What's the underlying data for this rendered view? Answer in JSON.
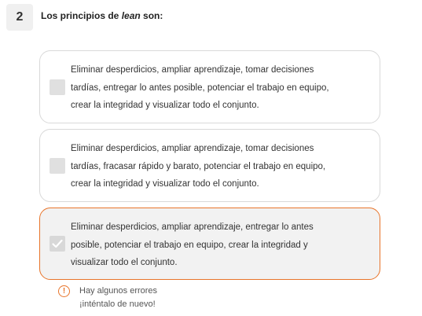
{
  "question": {
    "number": "2",
    "text_before": "Los principios de ",
    "text_emphasis": "lean",
    "text_after": " son:"
  },
  "options": [
    {
      "label": "Eliminar desperdicios, ampliar aprendizaje, tomar decisiones tardías, entregar lo antes posible, potenciar el trabajo en equipo, crear la integridad y visualizar todo el conjunto.",
      "checked": false
    },
    {
      "label": "Eliminar desperdicios, ampliar aprendizaje, tomar decisiones tardías, fracasar rápido y barato, potenciar el trabajo en equipo, crear la integridad y visualizar todo el conjunto.",
      "checked": false
    },
    {
      "label": "Eliminar desperdicios, ampliar aprendizaje, entregar lo antes posible, potenciar el trabajo en equipo, crear la integridad y visualizar todo el conjunto.",
      "checked": true
    }
  ],
  "error": {
    "icon": "exclamation-icon",
    "line1": "Hay algunos errores",
    "line2": "¡inténtalo de nuevo!"
  },
  "colors": {
    "accent": "#e8742a",
    "option_border": "#d9d9d9",
    "selected_bg": "#f2f2f2",
    "checkbox_bg": "#e0e0e0"
  }
}
